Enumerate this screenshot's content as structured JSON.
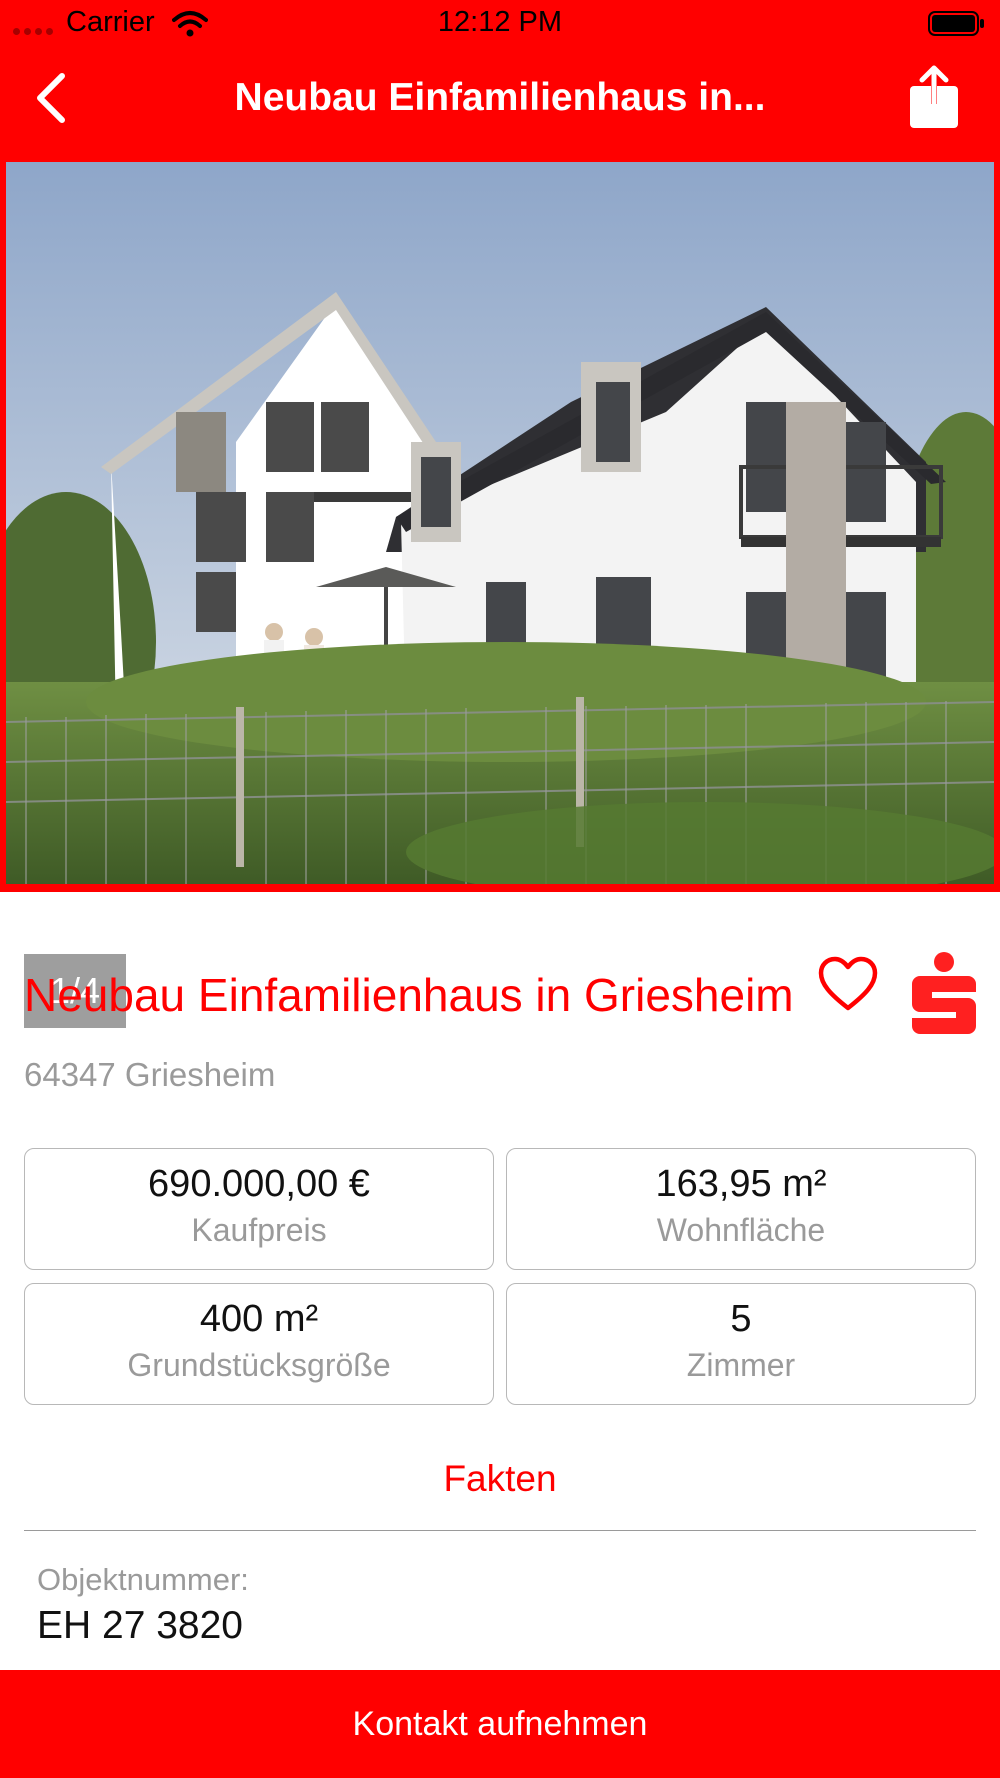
{
  "status_bar": {
    "carrier": "Carrier",
    "time": "12:12 PM",
    "icons": [
      "wifi-icon",
      "battery-icon"
    ]
  },
  "nav": {
    "title": "Neubau Einfamilienhaus in...",
    "back_icon": "chevron-left-icon",
    "share_icon": "share-icon"
  },
  "gallery": {
    "counter": "1/4",
    "favorite_icon": "heart-outline-icon",
    "logo_icon": "sparkasse-logo-icon"
  },
  "listing": {
    "title": "Neubau Einfamilienhaus in Griesheim",
    "location": "64347 Griesheim"
  },
  "facts": [
    {
      "value": "690.000,00 €",
      "label": "Kaufpreis"
    },
    {
      "value": "163,95 m²",
      "label": "Wohnfläche"
    },
    {
      "value": "400 m²",
      "label": "Grundstücksgröße"
    },
    {
      "value": "5",
      "label": "Zimmer"
    }
  ],
  "facts_section": {
    "heading": "Fakten",
    "object_number_label": "Objektnummer:",
    "object_number": "EH 27 3820"
  },
  "contact": {
    "label": "Kontakt aufnehmen"
  },
  "colors": {
    "accent": "#ff0000",
    "muted_text": "#9a9a9a",
    "card_border": "#b8b8b8"
  }
}
